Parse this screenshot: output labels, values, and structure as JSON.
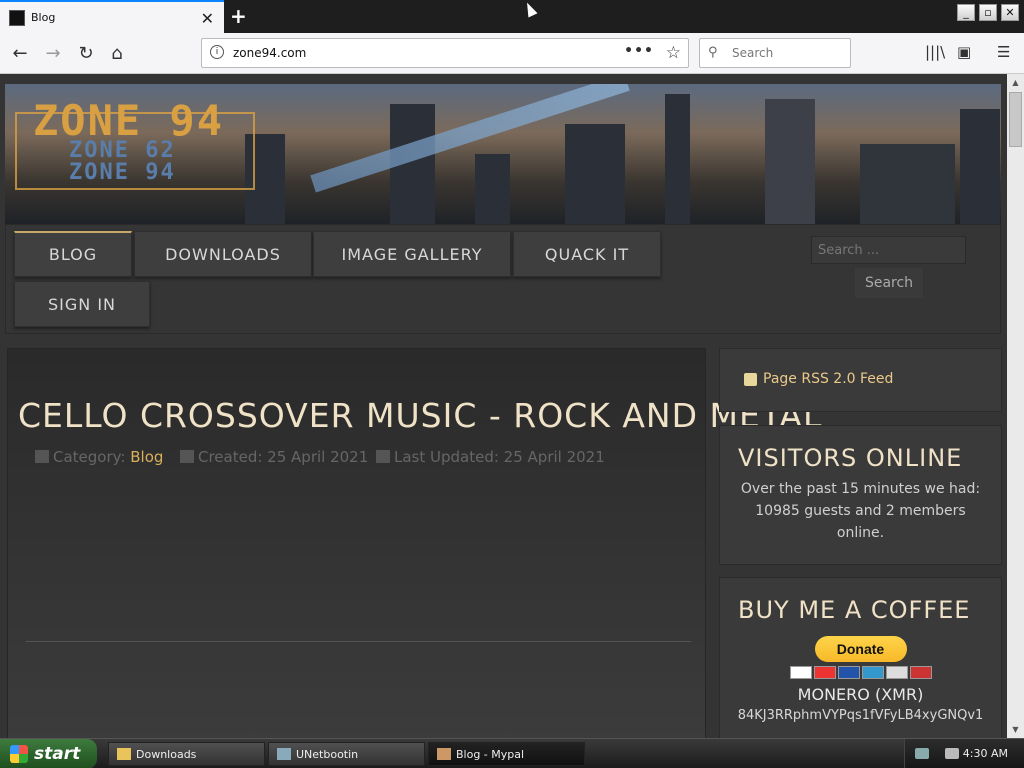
{
  "browser": {
    "tab_title": "Blog",
    "new_tab_label": "+",
    "url": "zone94.com",
    "search_placeholder": "Search",
    "page_actions": "•••",
    "window_buttons": [
      "_",
      "▫",
      "✕"
    ]
  },
  "site": {
    "logo_main": "ZONE 94",
    "logo_sub_1": "ZONE 62",
    "logo_sub_2": "ZONE 94",
    "menu": [
      "BLOG",
      "DOWNLOADS",
      "IMAGE GALLERY",
      "QUACK IT",
      "SIGN IN"
    ],
    "search_placeholder": "Search ...",
    "search_button": "Search"
  },
  "article": {
    "title": "CELLO CROSSOVER MUSIC - ROCK AND METAL",
    "category_label": "Category:",
    "category_value": "Blog",
    "created": "Created: 25 April 2021",
    "updated": "Last Updated: 25 April 2021"
  },
  "sidebar": {
    "rss_label": "Page RSS 2.0 Feed",
    "visitors_title": "VISITORS ONLINE",
    "visitors_text": "Over the past 15 minutes we had: 10985 guests and 2 members online.",
    "coffee_title": "BUY ME A COFFEE",
    "donate_label": "Donate",
    "monero_label": "MONERO (XMR)",
    "monero_address": "84KJ3RRphmVYPqs1fVFyLB4xyGNQv1"
  },
  "taskbar": {
    "start_label": "start",
    "tasks": [
      "Downloads",
      "UNetbootin",
      "Blog - Mypal"
    ],
    "clock": "4:30 AM"
  },
  "colors": {
    "accent_gold": "#d9a043",
    "title_cream": "#f0e2c6",
    "link_gold": "#d8b05a"
  }
}
